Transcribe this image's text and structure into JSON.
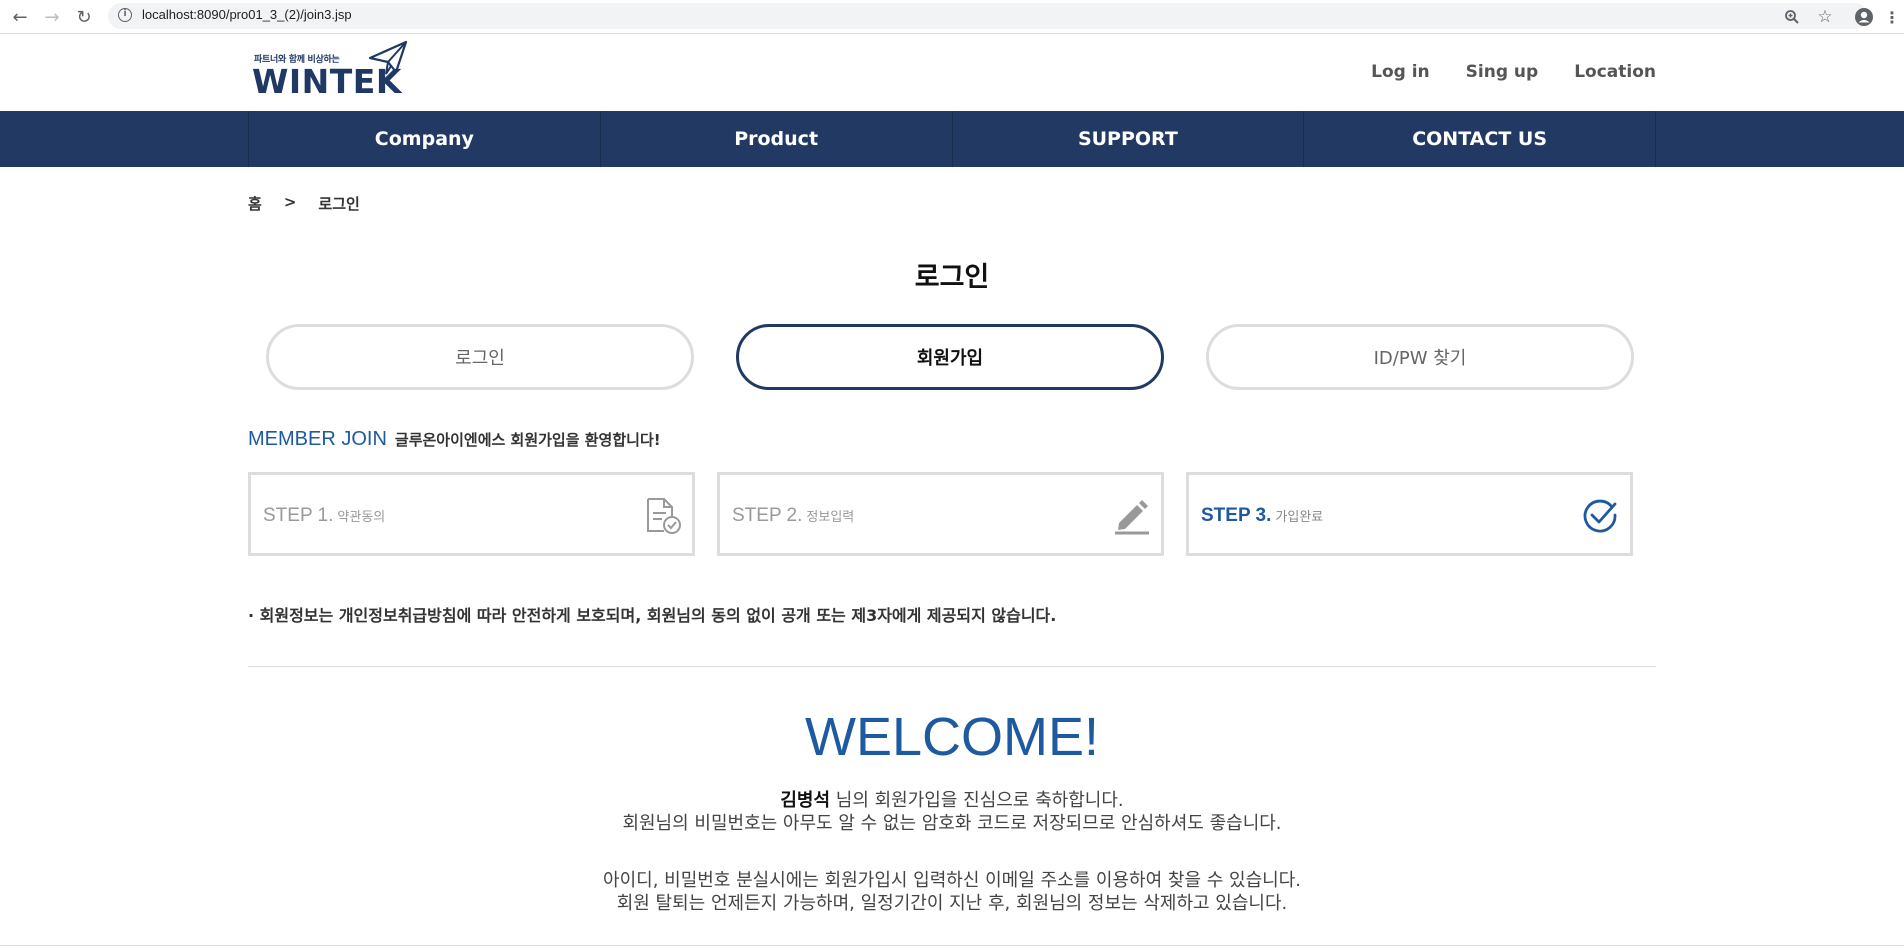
{
  "browser": {
    "url": "localhost:8090/pro01_3_(2)/join3.jsp"
  },
  "header": {
    "logo_tagline": "파트너와 함께 비상하는",
    "logo_name": "WINTEK",
    "links": [
      "Log in",
      "Sing up",
      "Location"
    ]
  },
  "gnb": {
    "items": [
      "Company",
      "Product",
      "SUPPORT",
      "CONTACT US"
    ]
  },
  "breadcrumb": {
    "home": "홈",
    "separator": ">",
    "current": "로그인"
  },
  "page_title": "로그인",
  "tabs": [
    {
      "label": "로그인",
      "active": false
    },
    {
      "label": "회원가입",
      "active": true
    },
    {
      "label": "ID/PW 찾기",
      "active": false
    }
  ],
  "member_join": {
    "title": "MEMBER JOIN",
    "subtitle": "글루온아이엔에스 회원가입을 환영합니다!"
  },
  "steps": [
    {
      "label": "STEP 1.",
      "desc": "약관동의",
      "icon": "document-check-icon",
      "active": false
    },
    {
      "label": "STEP 2.",
      "desc": "정보입력",
      "icon": "pencil-icon",
      "active": false
    },
    {
      "label": "STEP 3.",
      "desc": "가입완료",
      "icon": "check-circle-icon",
      "active": true
    }
  ],
  "notice": "· 회원정보는 개인정보취급방침에 따라 안전하게 보호되며, 회원님의 동의 없이 공개 또는 제3자에게 제공되지 않습니다.",
  "welcome": {
    "title": "WELCOME!",
    "user_name": "김병석",
    "line1_suffix": " 님의 회원가입을 진심으로 축하합니다.",
    "line2": "회원님의 비밀번호는 아무도 알 수 없는 암호화 코드로 저장되므로 안심하셔도 좋습니다.",
    "line3": "아이디, 비밀번호 분실시에는 회원가입시 입력하신 이메일 주소를 이용하여 찾을 수 있습니다.",
    "line4": "회원 탈퇴는 언제든지 가능하며, 일정기간이 지난 후, 회원님의 정보는 삭제하고 있습니다."
  },
  "colors": {
    "navy": "#223a63",
    "accent_blue": "#1e5aa0",
    "border_gray": "#dddddd"
  }
}
